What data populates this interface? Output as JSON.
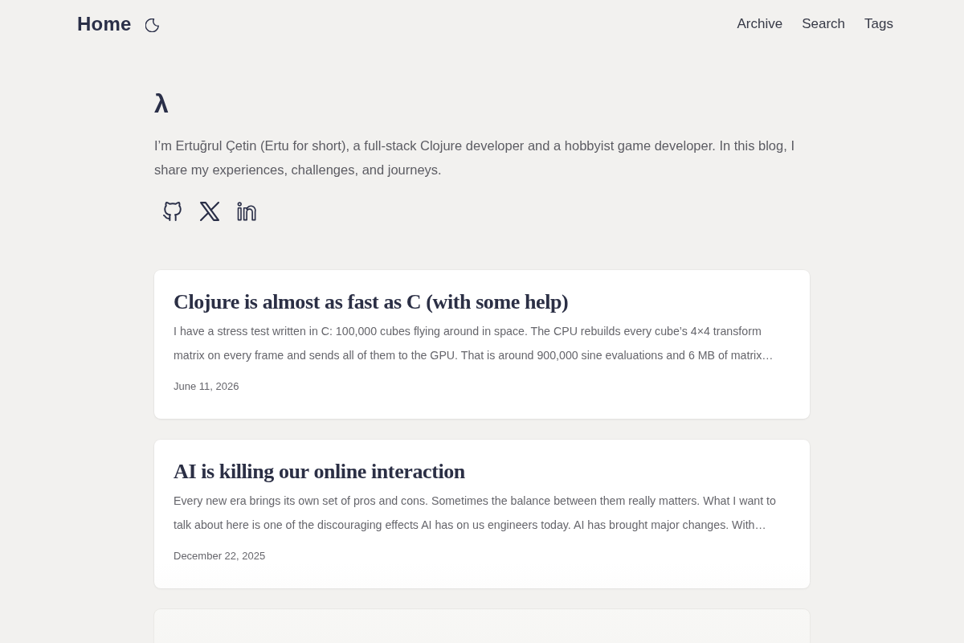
{
  "header": {
    "title": "Home",
    "nav": [
      "Archive",
      "Search",
      "Tags"
    ]
  },
  "intro": {
    "heading": "λ",
    "text": "I’m Ertuğrul Çetin (Ertu for short), a full-stack Clojure developer and a hobbyist game developer. In this blog, I share my experiences, challenges, and journeys."
  },
  "posts": [
    {
      "title": "Clojure is almost as fast as C (with some help)",
      "excerpt": "I have a stress test written in C: 100,000 cubes flying around in space. The CPU rebuilds every cube’s 4×4 transform matrix on every frame and sends all of them to the GPU. That is around 900,000 sine evaluations and 6 MB of matrix…",
      "date": "June 11, 2026"
    },
    {
      "title": "AI is killing our online interaction",
      "excerpt": "Every new era brings its own set of pros and cons. Sometimes the balance between them really matters. What I want to talk about here is one of the discouraging effects AI has on us engineers today. AI has brought major changes. With…",
      "date": "December 22, 2025"
    }
  ]
}
